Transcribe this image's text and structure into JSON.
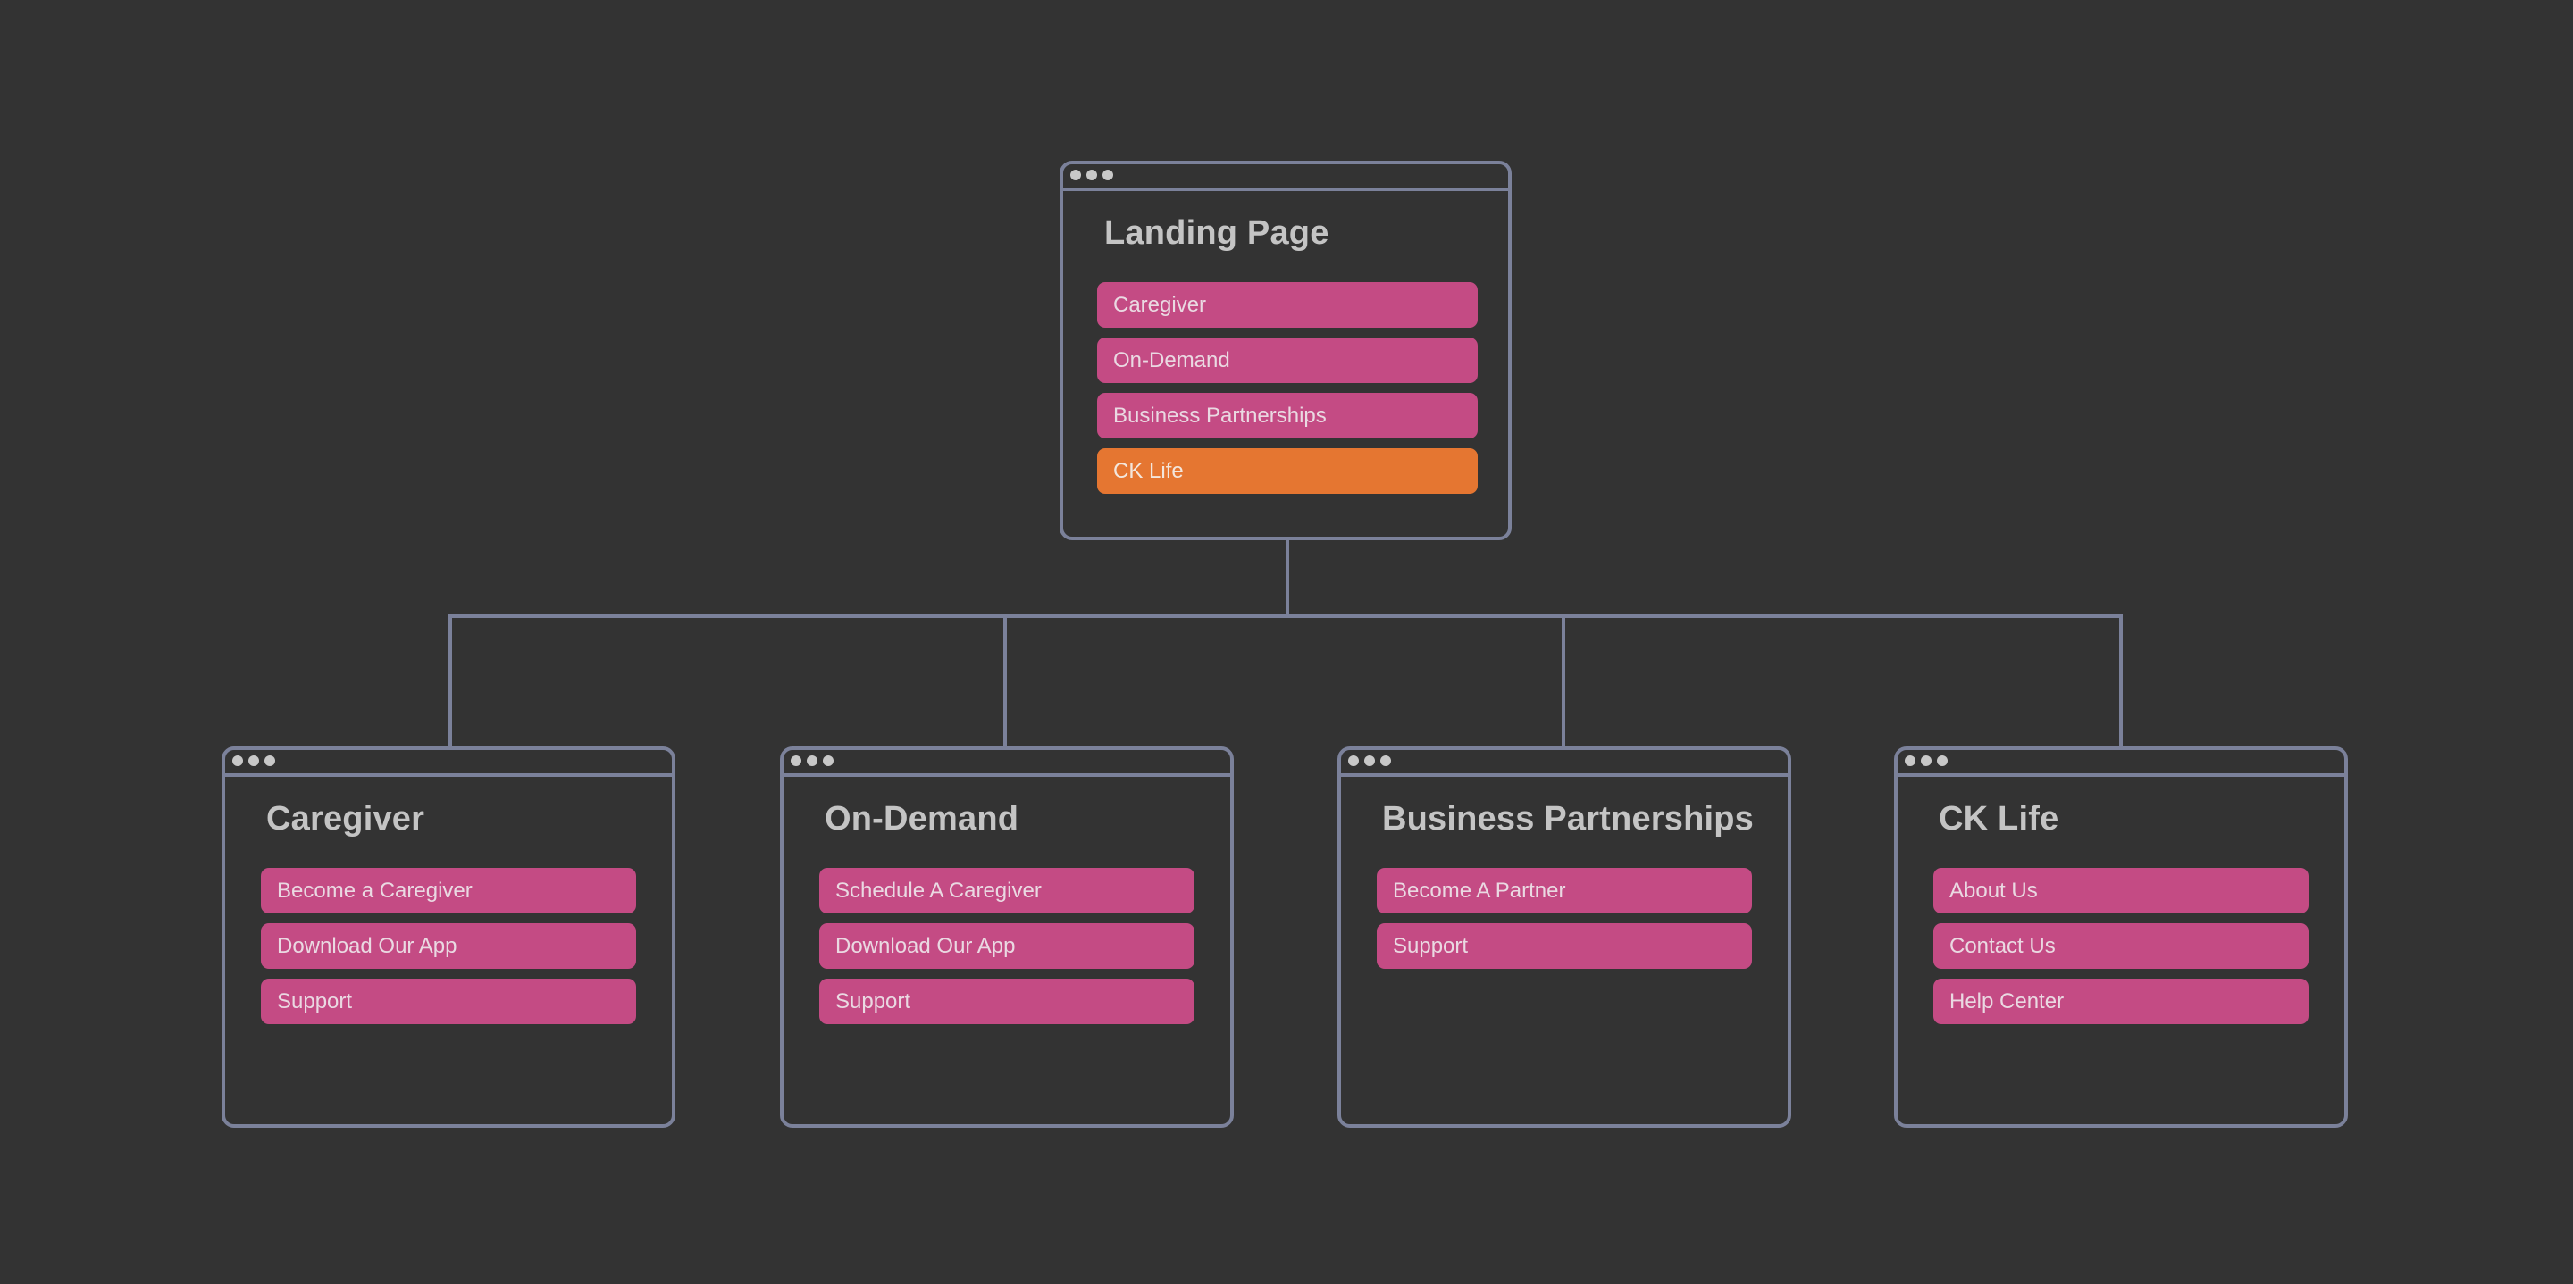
{
  "colors": {
    "background": "#333333",
    "frame": "#7b819a",
    "title_text": "#c4c4c4",
    "button_pink": "#c44b84",
    "button_orange": "#e57631",
    "button_text": "#ead9e2"
  },
  "root": {
    "title": "Landing Page",
    "buttons": [
      {
        "label": "Caregiver",
        "style": "pink"
      },
      {
        "label": "On-Demand",
        "style": "pink"
      },
      {
        "label": "Business Partnerships",
        "style": "pink"
      },
      {
        "label": "CK Life",
        "style": "orange"
      }
    ]
  },
  "children": [
    {
      "title": "Caregiver",
      "buttons": [
        {
          "label": "Become a Caregiver"
        },
        {
          "label": "Download Our App"
        },
        {
          "label": "Support"
        }
      ]
    },
    {
      "title": "On-Demand",
      "buttons": [
        {
          "label": "Schedule A Caregiver"
        },
        {
          "label": "Download Our App"
        },
        {
          "label": "Support"
        }
      ]
    },
    {
      "title": "Business Partnerships",
      "buttons": [
        {
          "label": "Become A Partner"
        },
        {
          "label": "Support"
        }
      ]
    },
    {
      "title": "CK Life",
      "buttons": [
        {
          "label": "About Us"
        },
        {
          "label": "Contact Us"
        },
        {
          "label": "Help Center"
        }
      ]
    }
  ]
}
